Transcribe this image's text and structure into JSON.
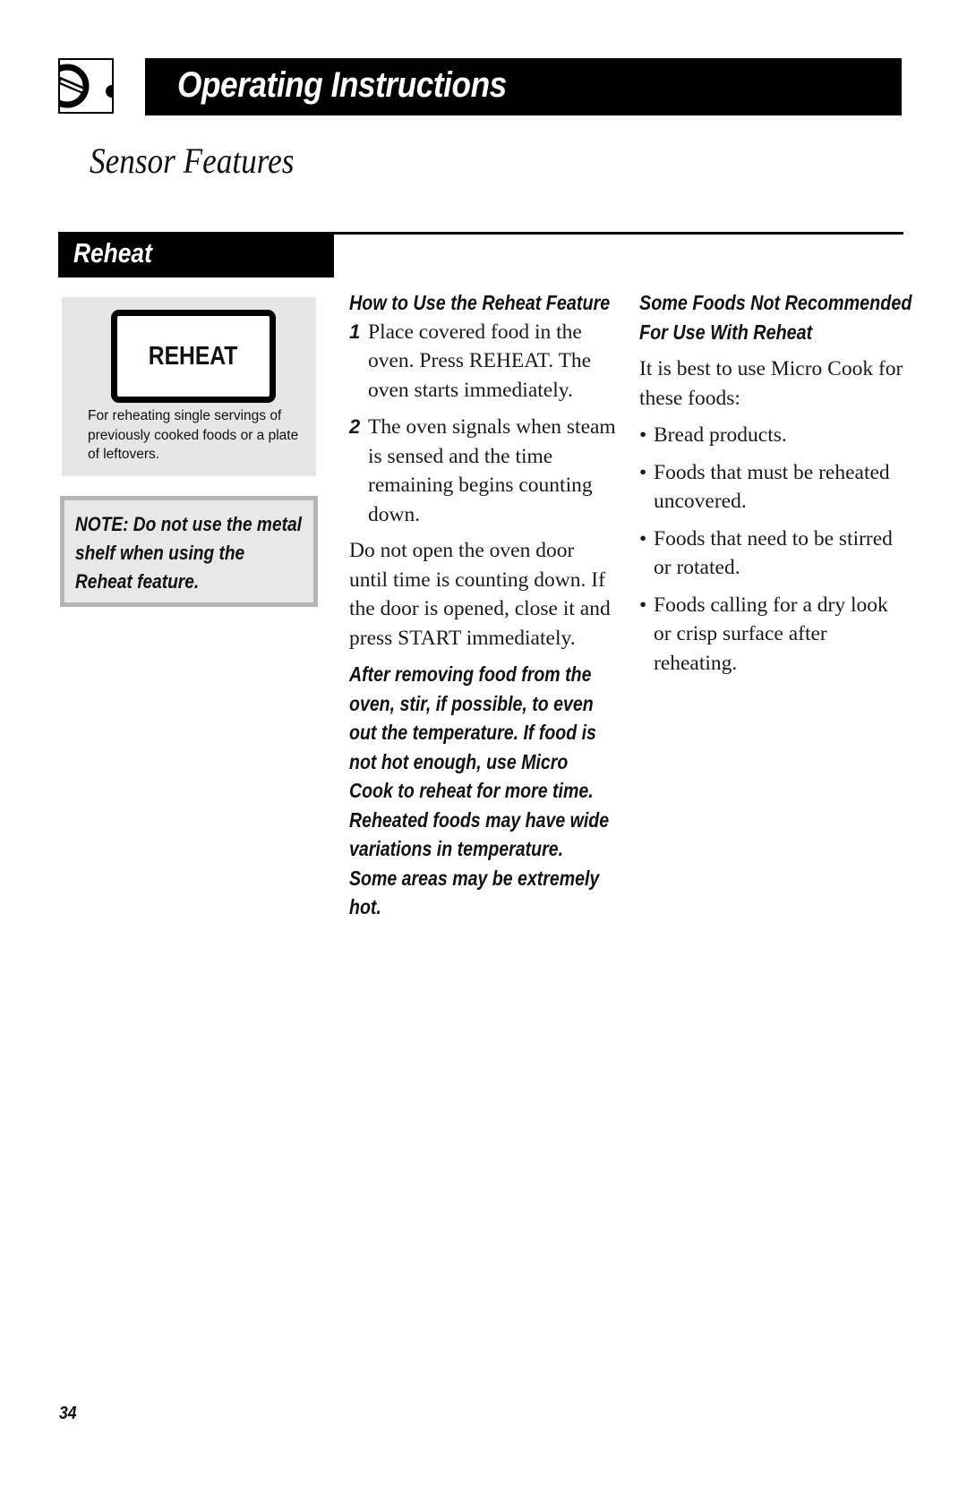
{
  "header": {
    "icon": "oven-dial-icon",
    "title": "Operating Instructions"
  },
  "section_title": "Sensor Features",
  "tab": {
    "label": "Reheat"
  },
  "left_column": {
    "key_label": "REHEAT",
    "key_description": "For reheating single servings of previously cooked foods or a plate of leftovers.",
    "note": "NOTE: Do not use the metal shelf when using the Reheat feature.",
    "panel_color": "#e6e6e6",
    "note_border_color": "#b5b5b5"
  },
  "middle_column": {
    "heading": "How to Use the Reheat Feature",
    "steps": [
      {
        "number": "1",
        "text": "Place covered food in the oven. Press REHEAT. The oven starts immediately."
      },
      {
        "number": "2",
        "text": "The oven signals when steam is sensed and the time remaining begins counting down."
      }
    ],
    "paragraph": "Do not open the oven door until time is counting down. If the door is opened, close it and press START immediately.",
    "warning": "After removing food from the oven, stir, if possible, to even out the temperature. If food is not hot enough, use Micro Cook to reheat for more time. Reheated foods may have wide variations in temperature. Some areas may be extremely hot."
  },
  "right_column": {
    "heading": "Some Foods Not Recommended For Use With Reheat",
    "intro": "It is best to use Micro Cook for these foods:",
    "bullet_symbol": "•",
    "bullets": [
      "Bread products.",
      "Foods that must be reheated uncovered.",
      "Foods that need to be stirred or rotated.",
      "Foods calling for a dry look or crisp surface after reheating."
    ]
  },
  "page_number": "34"
}
